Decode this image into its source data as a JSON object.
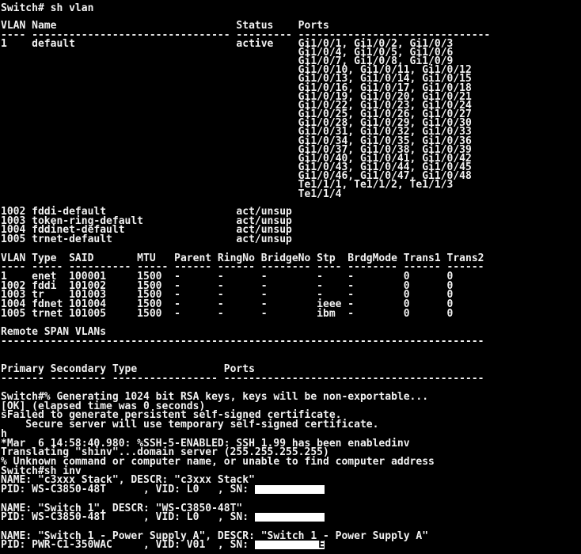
{
  "window": {
    "background": "#000000",
    "text_color": "#f2f2f2"
  },
  "vlan_brief": {
    "lines": [
      "Switch# sh vlan",
      "",
      "VLAN Name                             Status    Ports",
      "---- -------------------------------- --------- -------------------------------",
      "1    default                          active    Gi1/0/1, Gi1/0/2, Gi1/0/3",
      "                                                Gi1/0/4, Gi1/0/5, Gi1/0/6",
      "                                                Gi1/0/7, Gi1/0/8, Gi1/0/9",
      "                                                Gi1/0/10, Gi1/0/11, Gi1/0/12",
      "                                                Gi1/0/13, Gi1/0/14, Gi1/0/15",
      "                                                Gi1/0/16, Gi1/0/17, Gi1/0/18",
      "                                                Gi1/0/19, Gi1/0/20, Gi1/0/21",
      "                                                Gi1/0/22, Gi1/0/23, Gi1/0/24",
      "                                                Gi1/0/25, Gi1/0/26, Gi1/0/27",
      "                                                Gi1/0/28, Gi1/0/29, Gi1/0/30",
      "                                                Gi1/0/31, Gi1/0/32, Gi1/0/33",
      "                                                Gi1/0/34, Gi1/0/35, Gi1/0/36",
      "                                                Gi1/0/37, Gi1/0/38, Gi1/0/39",
      "                                                Gi1/0/40, Gi1/0/41, Gi1/0/42",
      "                                                Gi1/0/43, Gi1/0/44, Gi1/0/45",
      "                                                Gi1/0/46, Gi1/0/47, Gi1/0/48",
      "                                                Te1/1/1, Te1/1/2, Te1/1/3",
      "                                                Te1/1/4"
    ]
  },
  "output": {
    "lines": [
      "1002 fddi-default                     act/unsup",
      "1003 token-ring-default               act/unsup",
      "1004 fddinet-default                  act/unsup",
      "1005 trnet-default                    act/unsup",
      "",
      "VLAN Type  SAID       MTU   Parent RingNo BridgeNo Stp  BrdgMode Trans1 Trans2",
      "---- ----- ---------- ----- ------ ------ -------- ---- -------- ------ ------",
      "1    enet  100001     1500  -      -      -        -    -        0      0",
      "1002 fddi  101002     1500  -      -      -        -    -        0      0",
      "1003 tr    101003     1500  -      -      -        -    -        0      0",
      "1004 fdnet 101004     1500  -      -      -        ieee -        0      0",
      "1005 trnet 101005     1500  -      -      -        ibm  -        0      0",
      "",
      "Remote SPAN VLANs",
      "------------------------------------------------------------------------------",
      "",
      "",
      "Primary Secondary Type              Ports",
      "------- --------- ----------------- ------------------------------------------",
      "",
      "Switch#% Generating 1024 bit RSA keys, keys will be non-exportable...",
      "[OK] (elapsed time was 0 seconds)",
      "sFailed to generate persistent self-signed certificate.",
      "    Secure server will use temporary self-signed certificate.",
      "h",
      "*Mar  6 14:58:40.980: %SSH-5-ENABLED: SSH 1.99 has been enabledinv",
      "Translating \"shinv\"...domain server (255.255.255.255)",
      "% Unknown command or computer name, or unable to find computer address",
      "Switch#sh inv"
    ],
    "inventory": [
      {
        "name_line": "NAME: \"c3xxx Stack\", DESCR: \"c3xxx Stack\"",
        "pid_line": "PID: WS-C3850-48T      , VID: L0   , SN: ",
        "sn_visible": ""
      },
      {
        "name_line": "NAME: \"Switch 1\", DESCR: \"WS-C3850-48T\"",
        "pid_line": "PID: WS-C3850-48T      , VID: L0   , SN: ",
        "sn_visible": ""
      },
      {
        "name_line": "NAME: \"Switch 1 - Power Supply A\", DESCR: \"Switch 1 - Power Supply A\"",
        "pid_line": "PID: PWR-C1-350WAC     , VID: V01  , SN: ",
        "sn_visible": "E"
      }
    ]
  }
}
